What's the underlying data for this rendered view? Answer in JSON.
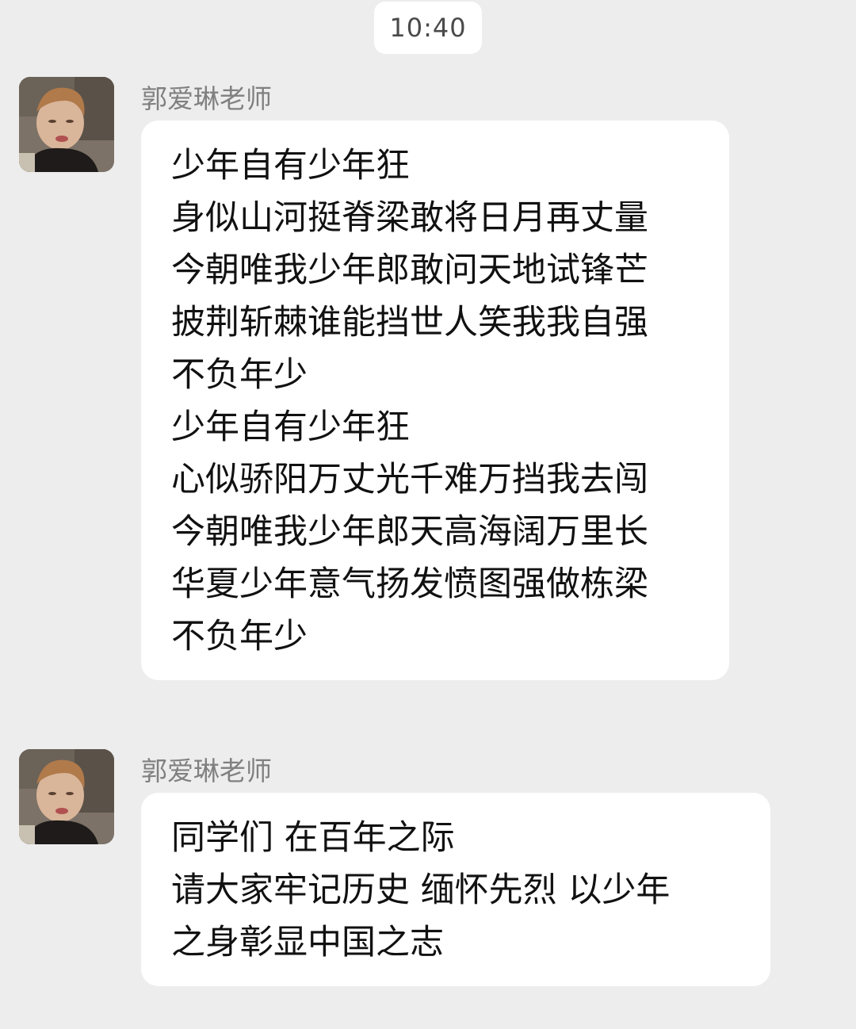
{
  "timestamp": "10:40",
  "messages": [
    {
      "sender": "郭爱琳老师",
      "avatar_icon": "toddler-photo-avatar",
      "lines": [
        "少年自有少年狂",
        "身似山河挺脊梁敢将日月再丈量",
        "今朝唯我少年郎敢问天地试锋芒",
        "披荆斩棘谁能挡世人笑我我自强",
        "不负年少",
        "少年自有少年狂",
        "心似骄阳万丈光千难万挡我去闯",
        "今朝唯我少年郎天高海阔万里长",
        "华夏少年意气扬发愤图强做栋梁",
        "不负年少"
      ]
    },
    {
      "sender": "郭爱琳老师",
      "avatar_icon": "toddler-photo-avatar",
      "lines": [
        "同学们  在百年之际",
        "请大家牢记历史 缅怀先烈 以少年",
        "之身彰显中国之志"
      ]
    }
  ],
  "colors": {
    "background": "#ededed",
    "bubble": "#ffffff",
    "sender_text": "#808080",
    "message_text": "#111111"
  }
}
